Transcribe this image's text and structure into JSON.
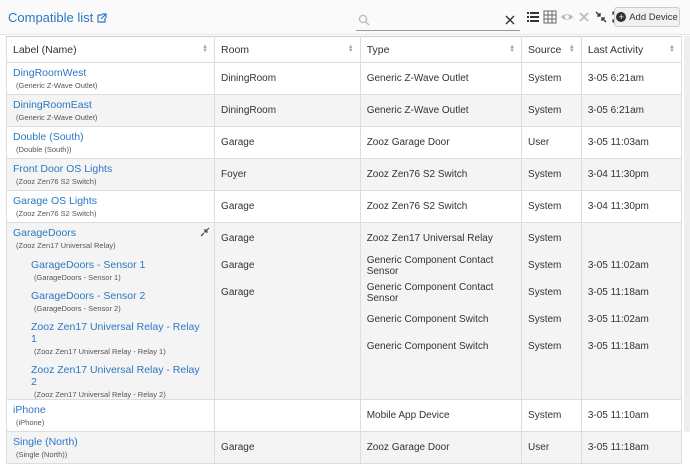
{
  "header": {
    "title": "Compatible list",
    "search_value": "",
    "add_button": "Add Device"
  },
  "columns": [
    "Label (Name)",
    "Room",
    "Type",
    "Source",
    "Last Activity"
  ],
  "rows": [
    {
      "label": "DingRoomWest",
      "name": "(Generic Z-Wave Outlet)",
      "room": "DiningRoom",
      "type": "Generic Z-Wave Outlet",
      "source": "System",
      "last": "3-05 6:21am"
    },
    {
      "label": "DiningRoomEast",
      "name": "(Generic Z-Wave Outlet)",
      "room": "DiningRoom",
      "type": "Generic Z-Wave Outlet",
      "source": "System",
      "last": "3-05 6:21am"
    },
    {
      "label": "Double (South)",
      "name": "(Double (South))",
      "room": "Garage",
      "type": "Zooz Garage Door",
      "source": "User",
      "last": "3-05 11:03am"
    },
    {
      "label": "Front Door OS Lights",
      "name": "(Zooz Zen76 S2 Switch)",
      "room": "Foyer",
      "type": "Zooz Zen76 S2 Switch",
      "source": "System",
      "last": "3-04 11:30pm"
    },
    {
      "label": "Garage OS Lights",
      "name": "(Zooz Zen76 S2 Switch)",
      "room": "Garage",
      "type": "Zooz Zen76 S2 Switch",
      "source": "System",
      "last": "3-04 11:30pm"
    }
  ],
  "group": {
    "label": "GarageDoors",
    "name": "(Zooz Zen17 Universal Relay)",
    "room": "Garage",
    "type": "Zooz Zen17 Universal Relay",
    "source": "System",
    "last": "",
    "children": [
      {
        "label": "GarageDoors - Sensor 1",
        "name": "(GarageDoors - Sensor 1)",
        "room": "Garage",
        "type": "Generic Component Contact Sensor",
        "source": "System",
        "last": "3-05 11:02am"
      },
      {
        "label": "GarageDoors - Sensor 2",
        "name": "(GarageDoors - Sensor 2)",
        "room": "Garage",
        "type": "Generic Component Contact Sensor",
        "source": "System",
        "last": "3-05 11:18am"
      },
      {
        "label": "Zooz Zen17 Universal Relay - Relay 1",
        "name": "(Zooz Zen17 Universal Relay - Relay 1)",
        "room": "",
        "type": "Generic Component Switch",
        "source": "System",
        "last": "3-05 11:02am"
      },
      {
        "label": "Zooz Zen17 Universal Relay - Relay 2",
        "name": "(Zooz Zen17 Universal Relay - Relay 2)",
        "room": "",
        "type": "Generic Component Switch",
        "source": "System",
        "last": "3-05 11:18am"
      }
    ]
  },
  "rows_after": [
    {
      "label": "iPhone",
      "name": "(iPhone)",
      "room": "",
      "type": "Mobile App Device",
      "source": "System",
      "last": "3-05 11:10am"
    },
    {
      "label": "Single (North)",
      "name": "(Single (North))",
      "room": "Garage",
      "type": "Zooz Garage Door",
      "source": "User",
      "last": "3-05 11:18am"
    }
  ],
  "colors": {
    "link": "#2b78c2",
    "stripe": "#f4f4f4"
  }
}
